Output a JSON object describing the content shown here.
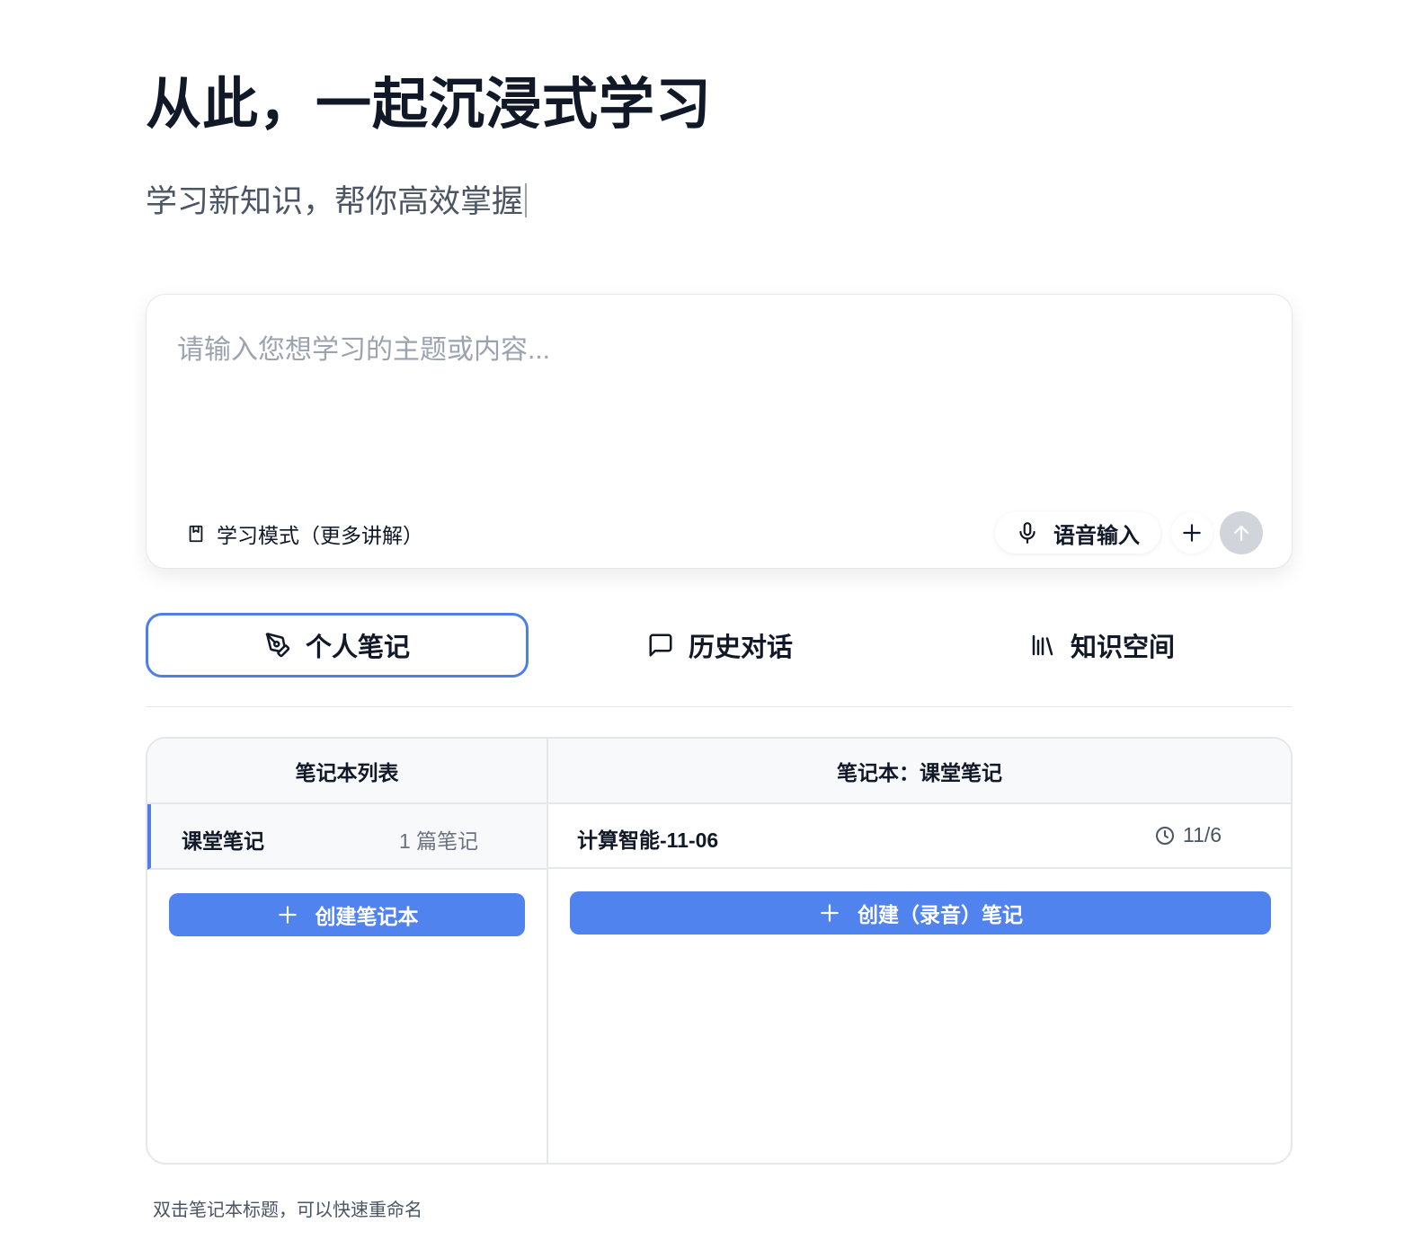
{
  "hero": {
    "title": "从此，一起沉浸式学习",
    "subtitle": "学习新知识，帮你高效掌握"
  },
  "composer": {
    "placeholder": "请输入您想学习的主题或内容...",
    "value": "",
    "mode_label": "学习模式（更多讲解）",
    "mode_icon": "bookmark-icon",
    "voice_label": "语音输入",
    "voice_icon": "microphone-icon",
    "add_icon": "plus-icon",
    "send_icon": "arrow-up-icon"
  },
  "tabs": [
    {
      "label": "个人笔记",
      "icon": "pen-tool-icon",
      "active": true
    },
    {
      "label": "历史对话",
      "icon": "message-square-icon",
      "active": false
    },
    {
      "label": "知识空间",
      "icon": "library-icon",
      "active": false
    }
  ],
  "notebooks": {
    "header": "笔记本列表",
    "items": [
      {
        "name": "课堂笔记",
        "count": "1 篇笔记",
        "selected": true
      }
    ],
    "create_label": "创建笔记本"
  },
  "notes": {
    "header": "笔记本：课堂笔记",
    "items": [
      {
        "title": "计算智能-11-06",
        "date": "11/6"
      }
    ],
    "create_label": "创建（录音）笔记"
  },
  "hint": "双击笔记本标题，可以快速重命名",
  "colors": {
    "accent": "#5183ee",
    "tab_border": "#4e7fe9",
    "send_disabled": "#d1d5db"
  }
}
